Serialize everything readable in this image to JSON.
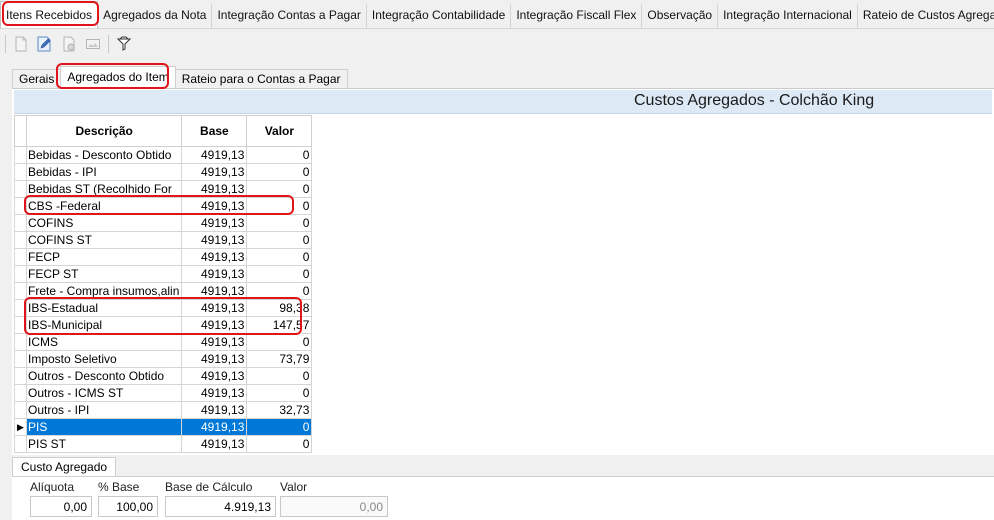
{
  "top_tabs": [
    "Itens Recebidos",
    "Agregados da Nota",
    "Integração Contas a Pagar",
    "Integração Contabilidade",
    "Integração Fiscall Flex",
    "Observação",
    "Integração Internacional",
    "Rateio de Custos Agregado"
  ],
  "toolbar": {
    "icons": [
      "new-document-icon",
      "edit-document-icon",
      "delete-document-icon",
      "image-icon",
      "filter-icon"
    ]
  },
  "sub_tabs": [
    "Gerais",
    "Agregados do Item",
    "Rateio para o Contas a Pagar"
  ],
  "panel": {
    "title": "Custos Agregados - Colchão King"
  },
  "grid": {
    "columns": [
      "Descrição",
      "Base",
      "Valor"
    ],
    "rows": [
      {
        "desc": "Bebidas - Desconto Obtido",
        "base": "4919,13",
        "valor": "0"
      },
      {
        "desc": "Bebidas - IPI",
        "base": "4919,13",
        "valor": "0"
      },
      {
        "desc": "Bebidas ST (Recolhido For",
        "base": "4919,13",
        "valor": "0"
      },
      {
        "desc": "CBS -Federal",
        "base": "4919,13",
        "valor": "0"
      },
      {
        "desc": "COFINS",
        "base": "4919,13",
        "valor": "0"
      },
      {
        "desc": "COFINS ST",
        "base": "4919,13",
        "valor": "0"
      },
      {
        "desc": "FECP",
        "base": "4919,13",
        "valor": "0"
      },
      {
        "desc": "FECP ST",
        "base": "4919,13",
        "valor": "0"
      },
      {
        "desc": "Frete - Compra insumos,alin",
        "base": "4919,13",
        "valor": "0"
      },
      {
        "desc": "IBS-Estadual",
        "base": "4919,13",
        "valor": "98,38"
      },
      {
        "desc": "IBS-Municipal",
        "base": "4919,13",
        "valor": "147,57"
      },
      {
        "desc": "ICMS",
        "base": "4919,13",
        "valor": "0"
      },
      {
        "desc": "Imposto Seletivo",
        "base": "4919,13",
        "valor": "73,79"
      },
      {
        "desc": "Outros - Desconto Obtido",
        "base": "4919,13",
        "valor": "0"
      },
      {
        "desc": "Outros - ICMS ST",
        "base": "4919,13",
        "valor": "0"
      },
      {
        "desc": "Outros - IPI",
        "base": "4919,13",
        "valor": "32,73"
      },
      {
        "desc": "PIS",
        "base": "4919,13",
        "valor": "0"
      },
      {
        "desc": "PIS ST",
        "base": "4919,13",
        "valor": "0"
      }
    ],
    "selected_row": 16,
    "row_indicator": "▶"
  },
  "bottom": {
    "tab_label": "Custo Agregado",
    "fields": [
      {
        "label": "Alíquota",
        "value": "0,00"
      },
      {
        "label": "% Base",
        "value": "100,00"
      },
      {
        "label": "Base de Cálculo",
        "value": "4.919,13"
      },
      {
        "label": "Valor",
        "value": "0,00"
      }
    ]
  },
  "colors": {
    "selection": "#0078d7",
    "highlight": "#e0151a",
    "header_band": "#dde9f5"
  }
}
